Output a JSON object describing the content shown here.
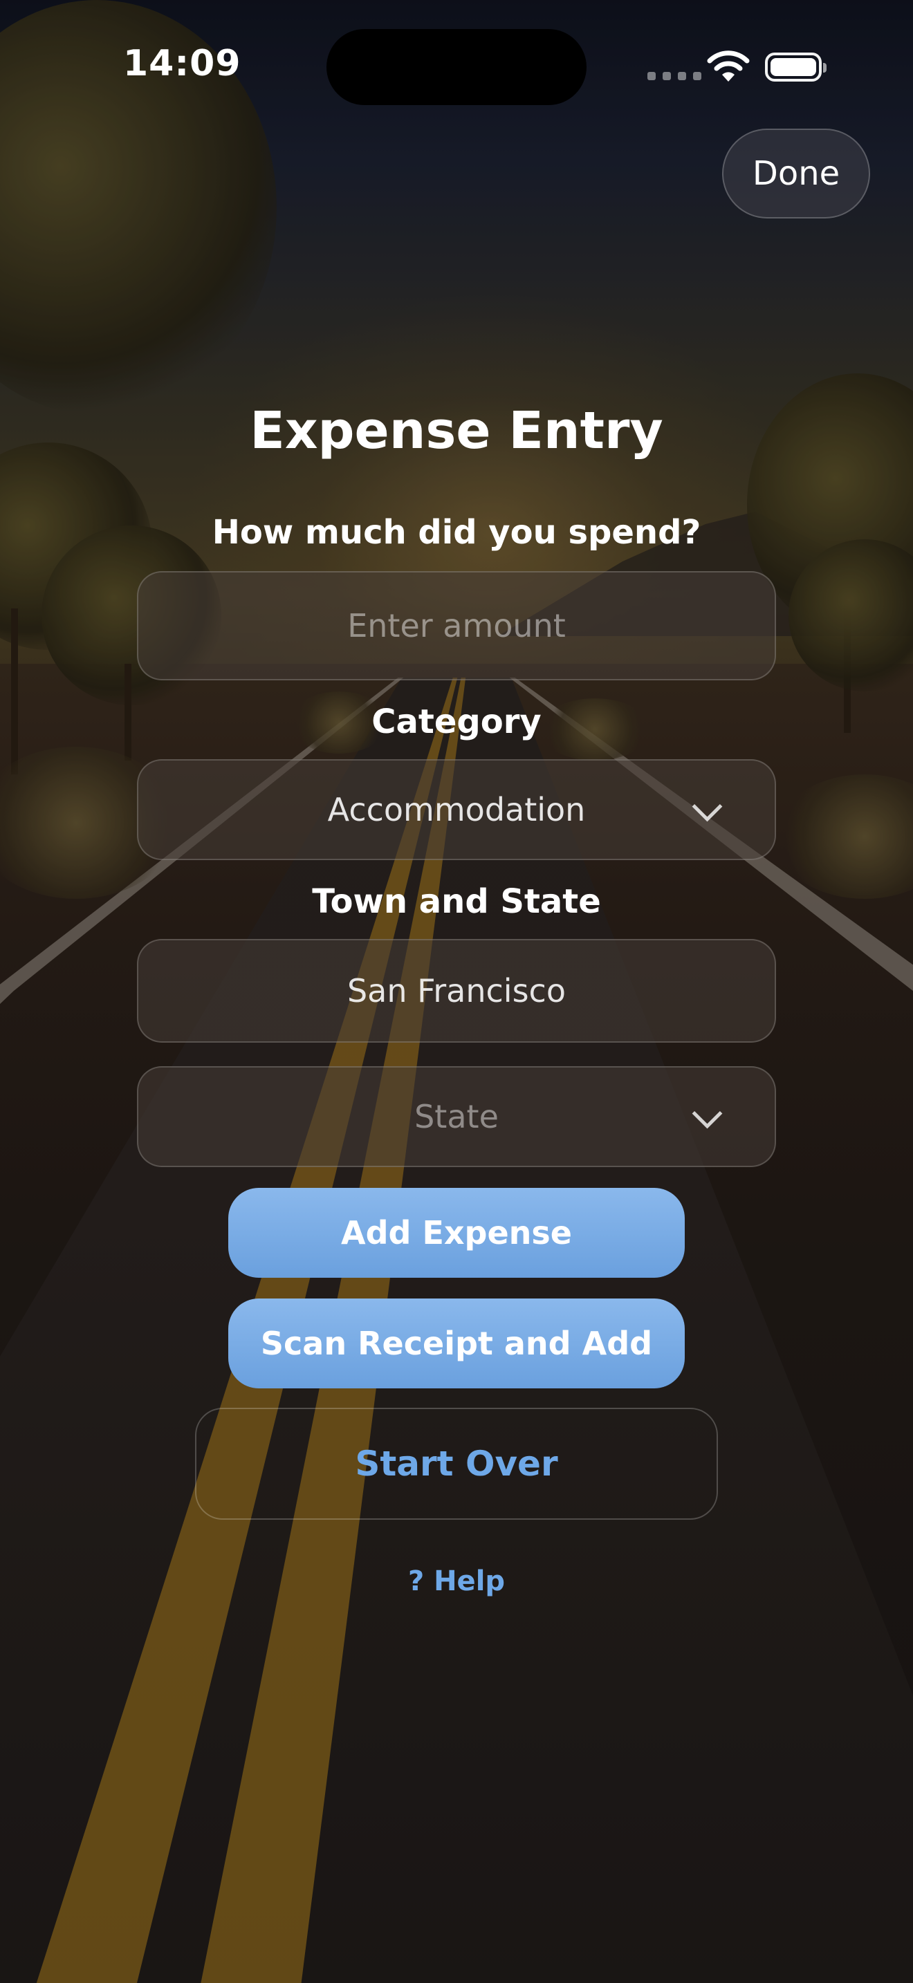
{
  "status_bar": {
    "time": "14:09",
    "wifi_icon": "wifi-icon",
    "battery_icon": "battery-icon"
  },
  "header": {
    "done_label": "Done"
  },
  "form": {
    "title": "Expense Entry",
    "amount_label": "How much did you spend?",
    "amount_placeholder": "Enter amount",
    "amount_value": "",
    "category_label": "Category",
    "category_value": "Accommodation",
    "location_label": "Town and State",
    "town_value": "San Francisco",
    "state_placeholder": "State",
    "add_button": "Add Expense",
    "scan_button": "Scan Receipt and Add",
    "start_over_button": "Start Over",
    "help_link": "? Help"
  },
  "colors": {
    "accent": "#6ea8e8",
    "primary_button": "#7aaee6"
  }
}
